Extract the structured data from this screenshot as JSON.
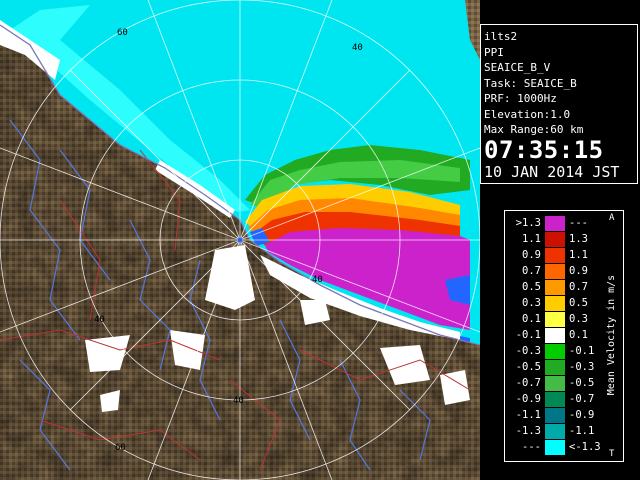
{
  "radar": {
    "site": "ilts2",
    "product": "PPI",
    "product_id": "SEAICE_B_V",
    "task": "Task: SEAICE_B",
    "prf": "PRF: 1000Hz",
    "elevation": "Elevation:1.0",
    "max_range": "Max Range:60 km",
    "time": "07:35:15",
    "date": "10 JAN 2014 JST",
    "range_ring_labels": [
      "60",
      "40",
      "40",
      "40",
      "60",
      "40"
    ]
  },
  "legend": {
    "unit_label": "Mean Velocity in m/s",
    "top_arrow": "A",
    "bottom_arrow": "T",
    "rows": [
      {
        "lo": ">1.3",
        "hi": "---",
        "color": "#cc22cc"
      },
      {
        "lo": "1.1",
        "hi": "1.3",
        "color": "#cc1100"
      },
      {
        "lo": "0.9",
        "hi": "1.1",
        "color": "#ee3300"
      },
      {
        "lo": "0.7",
        "hi": "0.9",
        "color": "#ff6600"
      },
      {
        "lo": "0.5",
        "hi": "0.7",
        "color": "#ff9900"
      },
      {
        "lo": "0.3",
        "hi": "0.5",
        "color": "#ffcc00"
      },
      {
        "lo": "0.1",
        "hi": "0.3",
        "color": "#ffff44"
      },
      {
        "lo": "-0.1",
        "hi": "0.1",
        "color": "#ffffff"
      },
      {
        "lo": "-0.3",
        "hi": "-0.1",
        "color": "#00cc00"
      },
      {
        "lo": "-0.5",
        "hi": "-0.3",
        "color": "#22aa22"
      },
      {
        "lo": "-0.7",
        "hi": "-0.5",
        "color": "#44bb44"
      },
      {
        "lo": "-0.9",
        "hi": "-0.7",
        "color": "#008855"
      },
      {
        "lo": "-1.1",
        "hi": "-0.9",
        "color": "#007788"
      },
      {
        "lo": "-1.3",
        "hi": "-1.1",
        "color": "#00aaaa"
      },
      {
        "lo": "---",
        "hi": "<-1.3",
        "color": "#00ffff"
      }
    ]
  },
  "colors": {
    "land": "#7a6446",
    "snow": "#ffffff",
    "sea_echo": "#00e6f0",
    "sea_echo_light": "#33ffff",
    "approaching_echo": "#cc22cc",
    "receding_echo": "#2266ff",
    "range_ring": "#ffffff",
    "rivers": "#5577dd",
    "roads": "#bb3333"
  }
}
